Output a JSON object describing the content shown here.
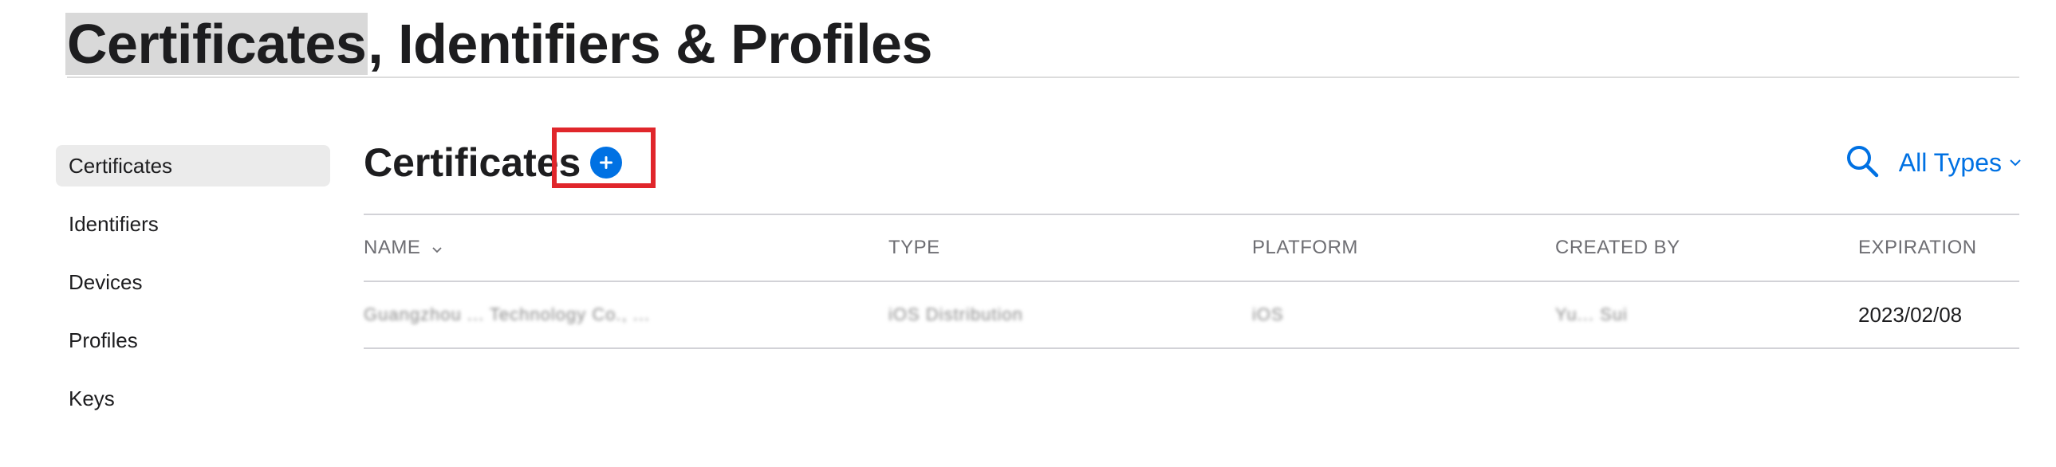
{
  "page": {
    "title_highlighted": "Certificates",
    "title_rest": ", Identifiers & Profiles"
  },
  "sidebar": {
    "items": [
      {
        "label": "Certificates",
        "active": true
      },
      {
        "label": "Identifiers",
        "active": false
      },
      {
        "label": "Devices",
        "active": false
      },
      {
        "label": "Profiles",
        "active": false
      },
      {
        "label": "Keys",
        "active": false
      }
    ]
  },
  "section": {
    "title": "Certificates",
    "add_icon": "plus-circle-icon",
    "search_icon": "magnifying-glass-icon",
    "filter_label": "All Types",
    "filter_icon": "chevron-down-icon"
  },
  "table": {
    "columns": [
      "NAME",
      "TYPE",
      "PLATFORM",
      "CREATED BY",
      "EXPIRATION"
    ],
    "rows": [
      {
        "name": "Guangzhou ... Technology Co., ...",
        "type": "iOS Distribution",
        "platform": "iOS",
        "created_by": "Yu... Sui",
        "expiration": "2023/02/08"
      }
    ]
  },
  "colors": {
    "accent": "#0071e3",
    "annotation_box": "#e0262b",
    "title_highlight": "#d9d9d9",
    "sidebar_active_bg": "#ebebeb",
    "divider": "#d2d2d7"
  }
}
